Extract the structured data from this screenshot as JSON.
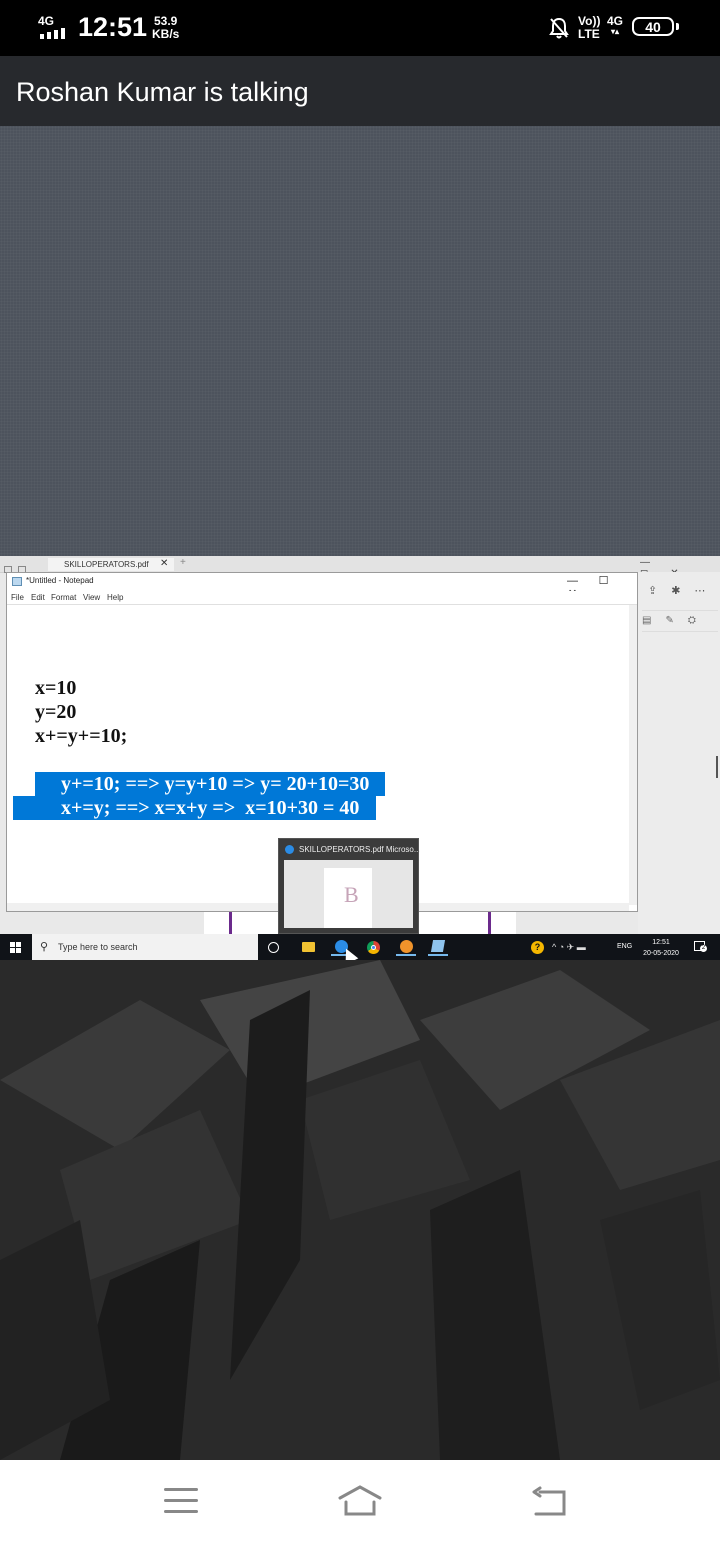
{
  "status_bar": {
    "network": "4G",
    "time": "12:51",
    "speed_value": "53.9",
    "speed_unit": "KB/s",
    "volte_line1": "Vo))",
    "volte_line2": "LTE",
    "network2": "4G",
    "network2_arrows": "▾▴",
    "battery": "40"
  },
  "header": {
    "title": "Roshan Kumar is talking"
  },
  "edge": {
    "tab_title": "SKILLOPERATORS.pdf",
    "tab_close": "✕",
    "new_tab": "+",
    "window_controls": "—◻✕",
    "toolbar_icons": "⇪✱⋯",
    "toolbar_row2": "▤✎⛭"
  },
  "notepad": {
    "title": "*Untitled - Notepad",
    "minimize": "—",
    "maximize": "☐",
    "close": "✕",
    "menu": [
      "File",
      "Edit",
      "Format",
      "View",
      "Help"
    ],
    "lines": [
      "x=10",
      "y=20",
      "x+=y+=10;",
      "y+=10; ==> y=y+10 => y= 20+10=30",
      "x+=y; ==> x=x+y =>  x=10+30 = 40"
    ]
  },
  "thumbnail": {
    "title": "SKILLOPERATORS.pdf  Microso...",
    "preview_text": "B"
  },
  "taskbar": {
    "search_placeholder": "Type here to search",
    "help": "?",
    "tray_icons": "^ ◔ ✈ ▬",
    "language": "ENG",
    "clock_time": "12:51",
    "clock_date": "20-05-2020",
    "notification_count": "2"
  },
  "colors": {
    "selection": "#0078d7",
    "header_bg": "#27292d",
    "gray_area": "#4d535d",
    "taskbar_bg": "#101318"
  }
}
